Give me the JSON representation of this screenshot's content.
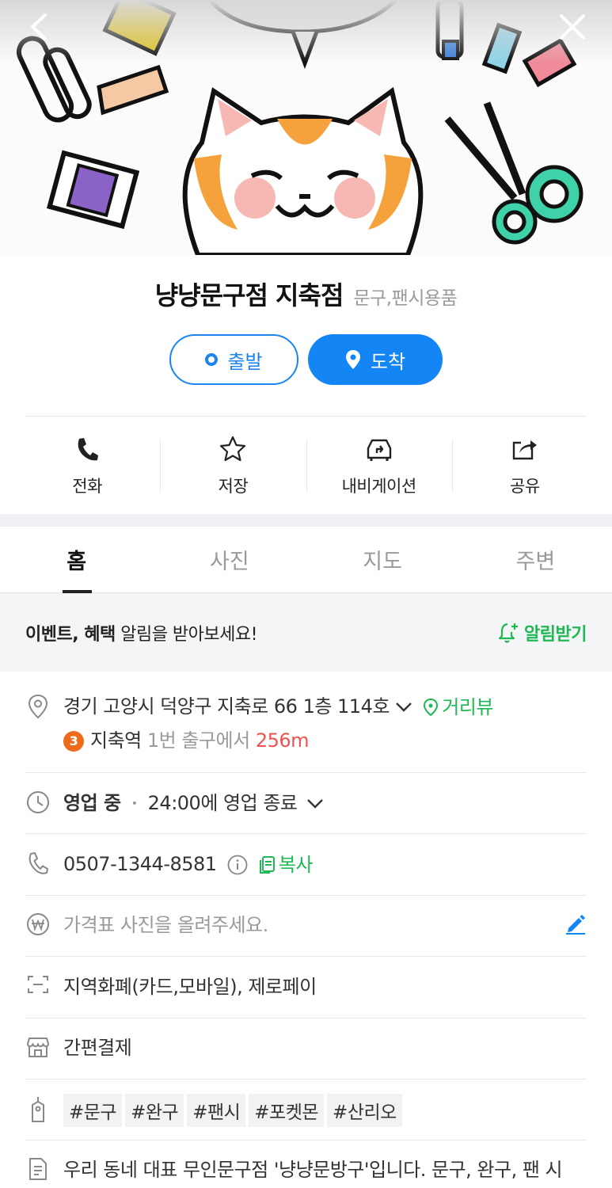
{
  "header": {
    "back_icon": "chevron-left-icon",
    "close_icon": "close-icon"
  },
  "place": {
    "name": "냥냥문구점 지축점",
    "category": "문구,팬시용품"
  },
  "route": {
    "start_label": "출발",
    "arrive_label": "도착",
    "accent_color": "#1485f5"
  },
  "actions": [
    {
      "label": "전화",
      "icon": "phone-icon"
    },
    {
      "label": "저장",
      "icon": "star-icon"
    },
    {
      "label": "내비게이션",
      "icon": "navigation-car-icon"
    },
    {
      "label": "공유",
      "icon": "share-icon"
    }
  ],
  "tabs": [
    {
      "label": "홈",
      "active": true
    },
    {
      "label": "사진",
      "active": false
    },
    {
      "label": "지도",
      "active": false
    },
    {
      "label": "주변",
      "active": false
    }
  ],
  "notice": {
    "bold": "이벤트, 혜택",
    "text": " 알림을 받아보세요!",
    "subscribe_label": "알림받기"
  },
  "info": {
    "address": "경기 고양시 덕양구 지축로 66 1층 114호",
    "street_view_label": "거리뷰",
    "subway_line": "3",
    "subway_station": "지축역",
    "subway_exit": " 1번 출구에서 ",
    "subway_distance": "256m",
    "hours_status": "영업 중",
    "hours_detail": "24:00에 영업 종료",
    "phone": "0507-1344-8581",
    "copy_label": "복사",
    "price_placeholder": "가격표 사진을 올려주세요.",
    "payment_local": "지역화폐(카드,모바일), 제로페이",
    "payment_easy": "간편결제",
    "tags": [
      "#문구",
      "#완구",
      "#팬시",
      "#포켓몬",
      "#산리오"
    ],
    "description": "우리 동네 대표 무인문구점 '냥냥문방구'입니다. 문구, 완구, 팬 시"
  },
  "colors": {
    "green": "#1fb954",
    "distance_red": "#ef5350",
    "subway_line3": "#ee6b1c"
  }
}
